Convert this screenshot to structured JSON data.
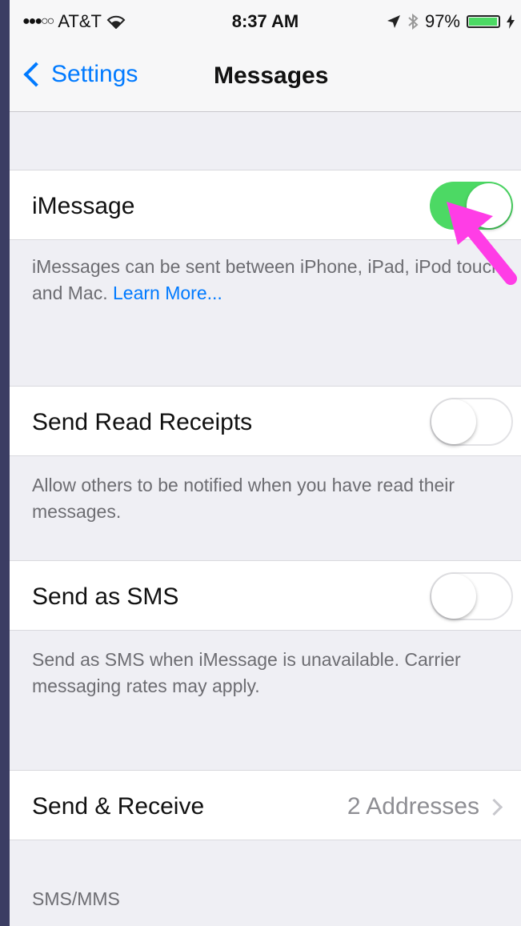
{
  "status_bar": {
    "carrier": "AT&T",
    "time": "8:37 AM",
    "battery": "97%",
    "battery_level": 0.97
  },
  "nav": {
    "back_label": "Settings",
    "title": "Messages"
  },
  "imessage": {
    "label": "iMessage",
    "on": true,
    "footer_text": "iMessages can be sent between iPhone, iPad, iPod touch, and Mac. ",
    "footer_link": "Learn More..."
  },
  "read_receipts": {
    "label": "Send Read Receipts",
    "on": false,
    "footer": "Allow others to be notified when you have read their messages."
  },
  "send_sms": {
    "label": "Send as SMS",
    "on": false,
    "footer": "Send as SMS when iMessage is unavailable. Carrier messaging rates may apply."
  },
  "send_receive": {
    "label": "Send & Receive",
    "detail": "2 Addresses"
  },
  "sms_section": {
    "header": "SMS/MMS"
  },
  "colors": {
    "accent": "#007aff",
    "toggle_on": "#4cd964",
    "annotation_arrow": "#ff3de6"
  }
}
